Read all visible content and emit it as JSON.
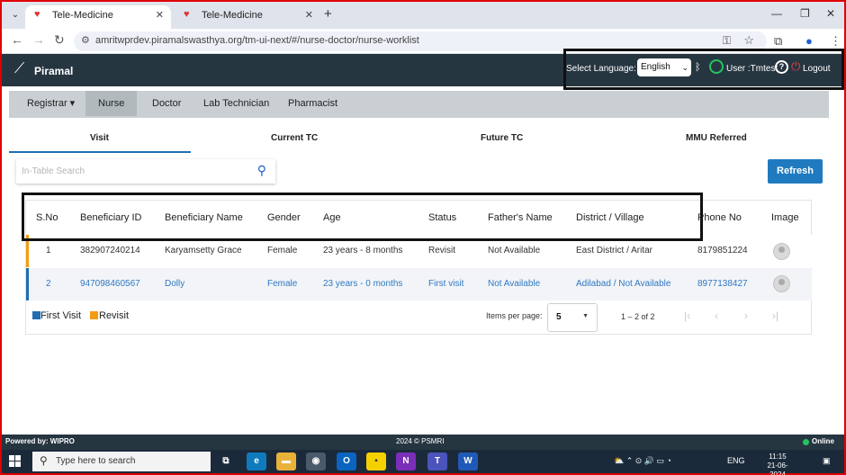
{
  "browser": {
    "tabs": [
      {
        "title": "Tele-Medicine"
      },
      {
        "title": "Tele-Medicine"
      }
    ],
    "url": "amritwprdev.piramalswasthya.org/tm-ui-next/#/nurse-doctor/nurse-worklist"
  },
  "header": {
    "logo_text": "Piramal",
    "language_label": "Select Language:",
    "language_value": "English",
    "user_text": "User :Tmtest",
    "logout_label": "Logout"
  },
  "roles": [
    {
      "label": "Registrar ▾"
    },
    {
      "label": "Nurse"
    },
    {
      "label": "Doctor"
    },
    {
      "label": "Lab Technician"
    },
    {
      "label": "Pharmacist"
    }
  ],
  "subtabs": [
    {
      "label": "Visit"
    },
    {
      "label": "Current TC"
    },
    {
      "label": "Future TC"
    },
    {
      "label": "MMU Referred"
    }
  ],
  "search": {
    "placeholder": "In-Table Search"
  },
  "refresh_label": "Refresh",
  "table": {
    "columns": [
      "S.No",
      "Beneficiary ID",
      "Beneficiary Name",
      "Gender",
      "Age",
      "Status",
      "Father's Name",
      "District / Village",
      "Phone No",
      "Image"
    ],
    "rows": [
      [
        "1",
        "382907240214",
        "Karyamsetty Grace",
        "Female",
        "23 years - 8 months",
        "Revisit",
        "Not Available",
        "East District / Aritar",
        "8179851224"
      ],
      [
        "2",
        "947098460567",
        "Dolly",
        "Female",
        "23 years - 0 months",
        "First visit",
        "Not Available",
        "Adilabad / Not Available",
        "8977138427"
      ]
    ]
  },
  "legend": [
    {
      "label": "First Visit",
      "color": "#1f6fb2"
    },
    {
      "label": "Revisit",
      "color": "#f39c12"
    }
  ],
  "paginator": {
    "items_label": "Items per page:",
    "page_size": "5",
    "range": "1 – 2 of 2"
  },
  "footer": {
    "left": "Powered by: WIPRO",
    "center": "2024 © PSMRI",
    "status": "Online"
  },
  "taskbar": {
    "search_placeholder": "Type here to search",
    "language": "ENG",
    "time": "11:15",
    "date": "21-06-2024"
  }
}
